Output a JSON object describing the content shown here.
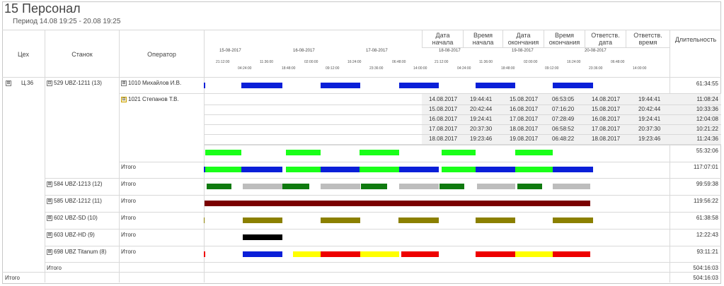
{
  "window": {
    "title": "15 Персонал",
    "period": "Период  14.08 19:25 - 20.08 19:25"
  },
  "columns": {
    "shop": "Цех",
    "machine": "Станок",
    "operator": "Оператор",
    "start_date": "Дата\nначала",
    "start_time": "Время\nначала",
    "end_date": "Дата\nокончания",
    "end_time": "Время\nокончания",
    "resp_date": "Ответств.\nдата",
    "resp_time": "Ответств.\nвремя",
    "duration": "Длительность"
  },
  "axis": {
    "dates": [
      "15-08-2017",
      "16-08-2017",
      "17-08-2017",
      "18-08-2017",
      "19-08-2017",
      "20-08-2017"
    ],
    "times_top": [
      "21:12:00",
      "11:36:00",
      "02:00:00",
      "16:24:00",
      "06:48:00",
      "21:12:00",
      "11:36:00",
      "02:00:00",
      "16:24:00",
      "06:48:00"
    ],
    "times_bottom": [
      "04:24:00",
      "18:48:00",
      "09:12:00",
      "23:36:00",
      "14:00:00",
      "04:24:00",
      "18:48:00",
      "09:12:00",
      "23:36:00",
      "14:00:00"
    ]
  },
  "shop": {
    "expander": "⊞",
    "name": "Ц.36"
  },
  "machines": [
    {
      "expander": "⊟",
      "name": "529 UBZ-1211 (13)",
      "total_label": "Итого",
      "total_duration": "117:07:01"
    },
    {
      "expander": "⊞",
      "name": "584 UBZ-1213 (12)",
      "total_label": "Итого",
      "total_duration": "99:59:38"
    },
    {
      "expander": "⊞",
      "name": "585 UBZ-1212 (11)",
      "total_label": "Итого",
      "total_duration": "119:56:22"
    },
    {
      "expander": "⊞",
      "name": "602 UBZ-SD (10)",
      "total_label": "Итого",
      "total_duration": "61:38:58"
    },
    {
      "expander": "⊞",
      "name": "603 UBZ-HD (9)",
      "total_label": "Итого",
      "total_duration": "12:22:43"
    },
    {
      "expander": "⊞",
      "name": "698 UBZ Titanum (8)",
      "total_label": "Итого",
      "total_duration": "93:11:21"
    }
  ],
  "operators": [
    {
      "expander": "⊞",
      "name": "1010 Михайлов И.В.",
      "duration": "61:34:55"
    },
    {
      "expander": "⊟",
      "name": "1021 Степанов Т.В.",
      "duration": "55:32:06"
    }
  ],
  "shifts": [
    [
      "14.08.2017",
      "19:44:41",
      "15.08.2017",
      "06:53:05",
      "14.08.2017",
      "19:44:41",
      "11:08:24"
    ],
    [
      "15.08.2017",
      "20:42:44",
      "16.08.2017",
      "07:16:20",
      "15.08.2017",
      "20:42:44",
      "10:33:36"
    ],
    [
      "16.08.2017",
      "19:24:41",
      "17.08.2017",
      "07:28:49",
      "16.08.2017",
      "19:24:41",
      "12:04:08"
    ],
    [
      "17.08.2017",
      "20:37:30",
      "18.08.2017",
      "06:58:52",
      "17.08.2017",
      "20:37:30",
      "10:21:22"
    ],
    [
      "18.08.2017",
      "19:23:46",
      "19.08.2017",
      "06:48:22",
      "18.08.2017",
      "19:23:46",
      "11:24:36"
    ]
  ],
  "shop_total": {
    "label": "Итого",
    "duration": "504:16:03"
  },
  "grand_total": {
    "label": "Итого",
    "duration": "504:16:03"
  },
  "colors": {
    "blue": "#0a1fd8",
    "green": "#19ff19",
    "dark_green": "#0f7a0f",
    "gray": "#bdbdbd",
    "maroon": "#7a0000",
    "olive": "#8b8000",
    "black": "#000000",
    "yellow": "#ffff00",
    "red": "#ee0000",
    "shade": "#f1f1f1"
  }
}
